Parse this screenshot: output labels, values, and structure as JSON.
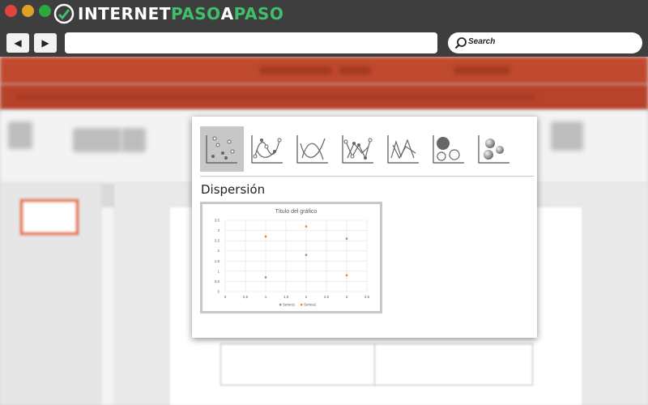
{
  "brand": {
    "part1": "INTERNET",
    "part2": "PASO",
    "part3": "A",
    "part4": "PASO",
    "color_white": "#ffffff",
    "color_green": "#3fbf6a"
  },
  "browser": {
    "back_icon": "back-arrow-icon",
    "forward_icon": "forward-arrow-icon",
    "back_glyph": "◀",
    "forward_glyph": "▶",
    "search_label": "Search",
    "dot_colors": [
      "#e0443e",
      "#dea123",
      "#29a93e"
    ]
  },
  "chart_picker": {
    "chart_types": [
      {
        "name": "scatter",
        "selected": true
      },
      {
        "name": "scatter-smooth-lines-markers",
        "selected": false
      },
      {
        "name": "scatter-smooth-lines",
        "selected": false
      },
      {
        "name": "scatter-straight-lines-markers",
        "selected": false
      },
      {
        "name": "scatter-straight-lines",
        "selected": false
      },
      {
        "name": "bubble",
        "selected": false
      },
      {
        "name": "bubble-3d",
        "selected": false
      }
    ],
    "section_title": "Dispersión"
  },
  "chart_data": {
    "type": "scatter",
    "title": "Título del gráfico",
    "xlabel": "",
    "ylabel": "",
    "xlim": [
      0,
      3.5
    ],
    "ylim": [
      0,
      3.5
    ],
    "x_ticks": [
      "0",
      "0,5",
      "1",
      "1,5",
      "2",
      "2,5",
      "3",
      "3,5"
    ],
    "y_ticks": [
      "0",
      "0,5",
      "1",
      "1,5",
      "2",
      "2,5",
      "3",
      "3,5"
    ],
    "grid": true,
    "legend_position": "bottom",
    "series": [
      {
        "name": "Series1",
        "color": "#5b9bd5",
        "points": [
          [
            1,
            0.7
          ],
          [
            2,
            1.8
          ],
          [
            3,
            2.6
          ]
        ]
      },
      {
        "name": "Series2",
        "color": "#ed7d31",
        "points": [
          [
            1,
            2.7
          ],
          [
            2,
            3.2
          ],
          [
            3,
            0.8
          ]
        ]
      }
    ]
  }
}
